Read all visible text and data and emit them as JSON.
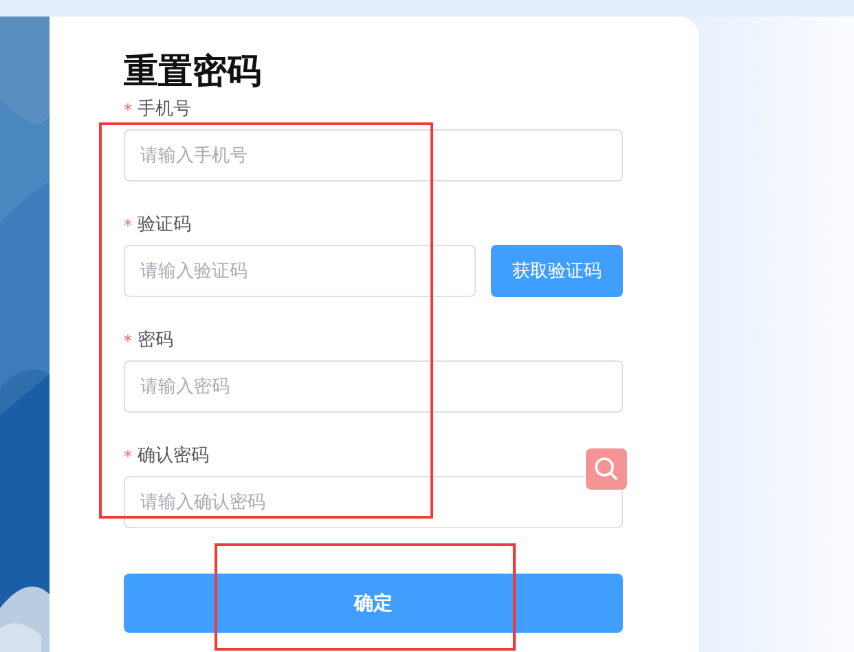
{
  "title": "重置密码",
  "fields": [
    {
      "mark": "*",
      "label": "手机号",
      "placeholder": "请输入手机号"
    },
    {
      "mark": "*",
      "label": "验证码",
      "placeholder": "请输入验证码",
      "action": "获取验证码"
    },
    {
      "mark": "*",
      "label": "密码",
      "placeholder": "请输入密码"
    },
    {
      "mark": "*",
      "label": "确认密码",
      "placeholder": "请输入确认密码"
    }
  ],
  "submit": "确定"
}
